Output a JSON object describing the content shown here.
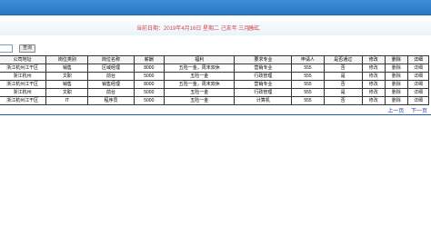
{
  "header": {
    "date_text": "当前日期：2019年4月16日 星期二 己亥年 三月十二",
    "logout_label": "退出"
  },
  "search": {
    "value": "",
    "button_label": "查询"
  },
  "table": {
    "columns": [
      "公司地址",
      "岗位类别",
      "岗位名称",
      "薪酬",
      "福利",
      "要求专业",
      "申请人",
      "是否通过",
      "修改",
      "删除",
      "详细"
    ],
    "rows": [
      [
        "浙江杭州江干区",
        "销售",
        "区域经理",
        "8000",
        "五险一金，周末双休",
        "营销专业",
        "555",
        "否",
        "修改",
        "删除",
        "详细"
      ],
      [
        "浙江杭州",
        "文职",
        "前台",
        "5000",
        "五险一金",
        "行政管理",
        "555",
        "是",
        "修改",
        "删除",
        "详细"
      ],
      [
        "浙江杭州江干区",
        "销售",
        "销售经理",
        "8000",
        "五险一金，周末双休",
        "营销专业",
        "555",
        "否",
        "修改",
        "删除",
        "详细"
      ],
      [
        "浙江杭州",
        "文职",
        "前台",
        "5000",
        "五险一金",
        "行政管理",
        "555",
        "是",
        "修改",
        "删除",
        "详细"
      ],
      [
        "浙江杭州江干区",
        "IT",
        "程序员",
        "5000",
        "五险一金",
        "计算机",
        "555",
        "否",
        "修改",
        "删除",
        "详细"
      ]
    ]
  },
  "pager": {
    "prev_label": "上一页",
    "next_label": "下一页"
  },
  "colors": {
    "topbar": "#2a77c4",
    "date_text": "#d24b4b",
    "pager_link": "#1a3fb4"
  }
}
